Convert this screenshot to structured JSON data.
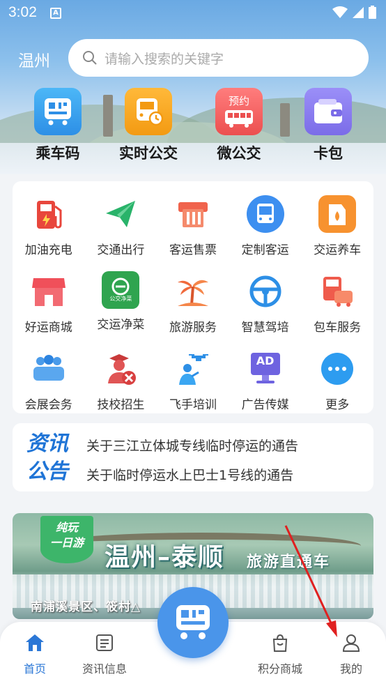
{
  "status": {
    "time": "3:02",
    "notif_letter": "A"
  },
  "header": {
    "city": "温州",
    "search_placeholder": "请输入搜索的关键字"
  },
  "quick": [
    {
      "label": "乘车码",
      "icon": "bus-qr-icon",
      "color": "#3aa6f2"
    },
    {
      "label": "实时公交",
      "icon": "realtime-bus-icon",
      "color": "#f6a623"
    },
    {
      "label": "微公交",
      "icon": "booking-bus-icon",
      "color": "#f26464",
      "badge": "预约"
    },
    {
      "label": "卡包",
      "icon": "wallet-icon",
      "color": "#8a7ef0"
    }
  ],
  "services": [
    {
      "label": "加油充电",
      "icon": "fuel-charge-icon"
    },
    {
      "label": "交通出行",
      "icon": "paper-plane-icon"
    },
    {
      "label": "客运售票",
      "icon": "ticket-icon"
    },
    {
      "label": "定制客运",
      "icon": "custom-bus-icon"
    },
    {
      "label": "交运养车",
      "icon": "car-oil-icon"
    },
    {
      "label": "好运商城",
      "icon": "shop-icon"
    },
    {
      "label": "交运净菜",
      "icon": "fresh-food-icon",
      "sub": "公交净菜"
    },
    {
      "label": "旅游服务",
      "icon": "palm-tree-icon"
    },
    {
      "label": "智慧驾培",
      "icon": "steering-wheel-icon"
    },
    {
      "label": "包车服务",
      "icon": "charter-bus-icon"
    },
    {
      "label": "会展会务",
      "icon": "meeting-icon"
    },
    {
      "label": "技校招生",
      "icon": "student-icon"
    },
    {
      "label": "飞手培训",
      "icon": "drone-pilot-icon"
    },
    {
      "label": "广告传媒",
      "icon": "ad-screen-icon",
      "sub": "AD"
    },
    {
      "label": "更多",
      "icon": "more-icon"
    }
  ],
  "news": {
    "badge_top": "资讯",
    "badge_bottom": "公告",
    "items": [
      "关于三江立体城专线临时停运的通告",
      "关于临时停运水上巴士1号线的通告"
    ]
  },
  "banner": {
    "tag": "纯玩\n一日游",
    "title": "温州–泰顺",
    "subtitle": "旅游直通车",
    "caption": "南浦溪景区、筱村△"
  },
  "tabbar": {
    "items": [
      {
        "label": "首页"
      },
      {
        "label": "资讯信息"
      },
      {
        "label": "积分商城"
      },
      {
        "label": "我的"
      }
    ]
  },
  "colors": {
    "primary": "#2b77d6",
    "annotation": "#e02020"
  }
}
